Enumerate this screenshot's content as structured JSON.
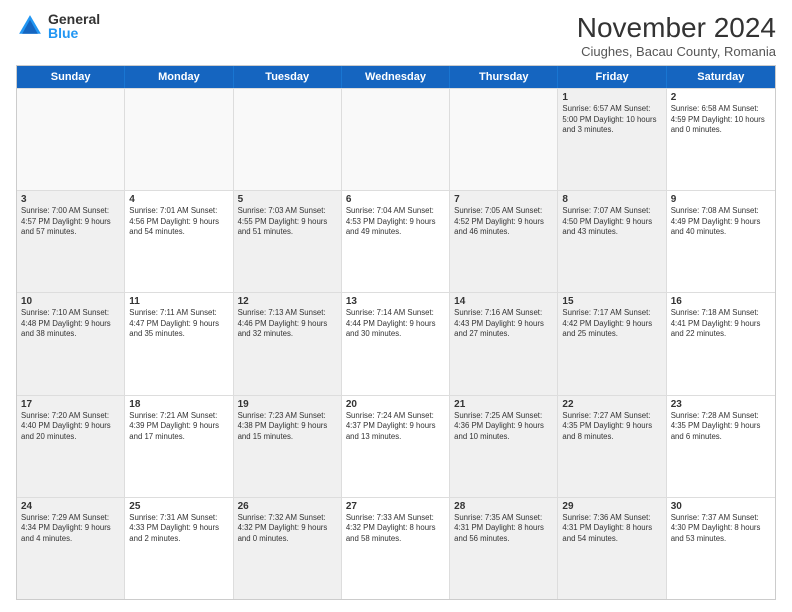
{
  "logo": {
    "general": "General",
    "blue": "Blue"
  },
  "header": {
    "month": "November 2024",
    "location": "Ciughes, Bacau County, Romania"
  },
  "weekdays": [
    "Sunday",
    "Monday",
    "Tuesday",
    "Wednesday",
    "Thursday",
    "Friday",
    "Saturday"
  ],
  "rows": [
    [
      {
        "day": "",
        "info": "",
        "empty": true
      },
      {
        "day": "",
        "info": "",
        "empty": true
      },
      {
        "day": "",
        "info": "",
        "empty": true
      },
      {
        "day": "",
        "info": "",
        "empty": true
      },
      {
        "day": "",
        "info": "",
        "empty": true
      },
      {
        "day": "1",
        "info": "Sunrise: 6:57 AM\nSunset: 5:00 PM\nDaylight: 10 hours\nand 3 minutes.",
        "shaded": true
      },
      {
        "day": "2",
        "info": "Sunrise: 6:58 AM\nSunset: 4:59 PM\nDaylight: 10 hours\nand 0 minutes."
      }
    ],
    [
      {
        "day": "3",
        "info": "Sunrise: 7:00 AM\nSunset: 4:57 PM\nDaylight: 9 hours\nand 57 minutes.",
        "shaded": true
      },
      {
        "day": "4",
        "info": "Sunrise: 7:01 AM\nSunset: 4:56 PM\nDaylight: 9 hours\nand 54 minutes."
      },
      {
        "day": "5",
        "info": "Sunrise: 7:03 AM\nSunset: 4:55 PM\nDaylight: 9 hours\nand 51 minutes.",
        "shaded": true
      },
      {
        "day": "6",
        "info": "Sunrise: 7:04 AM\nSunset: 4:53 PM\nDaylight: 9 hours\nand 49 minutes."
      },
      {
        "day": "7",
        "info": "Sunrise: 7:05 AM\nSunset: 4:52 PM\nDaylight: 9 hours\nand 46 minutes.",
        "shaded": true
      },
      {
        "day": "8",
        "info": "Sunrise: 7:07 AM\nSunset: 4:50 PM\nDaylight: 9 hours\nand 43 minutes.",
        "shaded": true
      },
      {
        "day": "9",
        "info": "Sunrise: 7:08 AM\nSunset: 4:49 PM\nDaylight: 9 hours\nand 40 minutes."
      }
    ],
    [
      {
        "day": "10",
        "info": "Sunrise: 7:10 AM\nSunset: 4:48 PM\nDaylight: 9 hours\nand 38 minutes.",
        "shaded": true
      },
      {
        "day": "11",
        "info": "Sunrise: 7:11 AM\nSunset: 4:47 PM\nDaylight: 9 hours\nand 35 minutes."
      },
      {
        "day": "12",
        "info": "Sunrise: 7:13 AM\nSunset: 4:46 PM\nDaylight: 9 hours\nand 32 minutes.",
        "shaded": true
      },
      {
        "day": "13",
        "info": "Sunrise: 7:14 AM\nSunset: 4:44 PM\nDaylight: 9 hours\nand 30 minutes."
      },
      {
        "day": "14",
        "info": "Sunrise: 7:16 AM\nSunset: 4:43 PM\nDaylight: 9 hours\nand 27 minutes.",
        "shaded": true
      },
      {
        "day": "15",
        "info": "Sunrise: 7:17 AM\nSunset: 4:42 PM\nDaylight: 9 hours\nand 25 minutes.",
        "shaded": true
      },
      {
        "day": "16",
        "info": "Sunrise: 7:18 AM\nSunset: 4:41 PM\nDaylight: 9 hours\nand 22 minutes."
      }
    ],
    [
      {
        "day": "17",
        "info": "Sunrise: 7:20 AM\nSunset: 4:40 PM\nDaylight: 9 hours\nand 20 minutes.",
        "shaded": true
      },
      {
        "day": "18",
        "info": "Sunrise: 7:21 AM\nSunset: 4:39 PM\nDaylight: 9 hours\nand 17 minutes."
      },
      {
        "day": "19",
        "info": "Sunrise: 7:23 AM\nSunset: 4:38 PM\nDaylight: 9 hours\nand 15 minutes.",
        "shaded": true
      },
      {
        "day": "20",
        "info": "Sunrise: 7:24 AM\nSunset: 4:37 PM\nDaylight: 9 hours\nand 13 minutes."
      },
      {
        "day": "21",
        "info": "Sunrise: 7:25 AM\nSunset: 4:36 PM\nDaylight: 9 hours\nand 10 minutes.",
        "shaded": true
      },
      {
        "day": "22",
        "info": "Sunrise: 7:27 AM\nSunset: 4:35 PM\nDaylight: 9 hours\nand 8 minutes.",
        "shaded": true
      },
      {
        "day": "23",
        "info": "Sunrise: 7:28 AM\nSunset: 4:35 PM\nDaylight: 9 hours\nand 6 minutes."
      }
    ],
    [
      {
        "day": "24",
        "info": "Sunrise: 7:29 AM\nSunset: 4:34 PM\nDaylight: 9 hours\nand 4 minutes.",
        "shaded": true
      },
      {
        "day": "25",
        "info": "Sunrise: 7:31 AM\nSunset: 4:33 PM\nDaylight: 9 hours\nand 2 minutes."
      },
      {
        "day": "26",
        "info": "Sunrise: 7:32 AM\nSunset: 4:32 PM\nDaylight: 9 hours\nand 0 minutes.",
        "shaded": true
      },
      {
        "day": "27",
        "info": "Sunrise: 7:33 AM\nSunset: 4:32 PM\nDaylight: 8 hours\nand 58 minutes."
      },
      {
        "day": "28",
        "info": "Sunrise: 7:35 AM\nSunset: 4:31 PM\nDaylight: 8 hours\nand 56 minutes.",
        "shaded": true
      },
      {
        "day": "29",
        "info": "Sunrise: 7:36 AM\nSunset: 4:31 PM\nDaylight: 8 hours\nand 54 minutes.",
        "shaded": true
      },
      {
        "day": "30",
        "info": "Sunrise: 7:37 AM\nSunset: 4:30 PM\nDaylight: 8 hours\nand 53 minutes."
      }
    ]
  ]
}
